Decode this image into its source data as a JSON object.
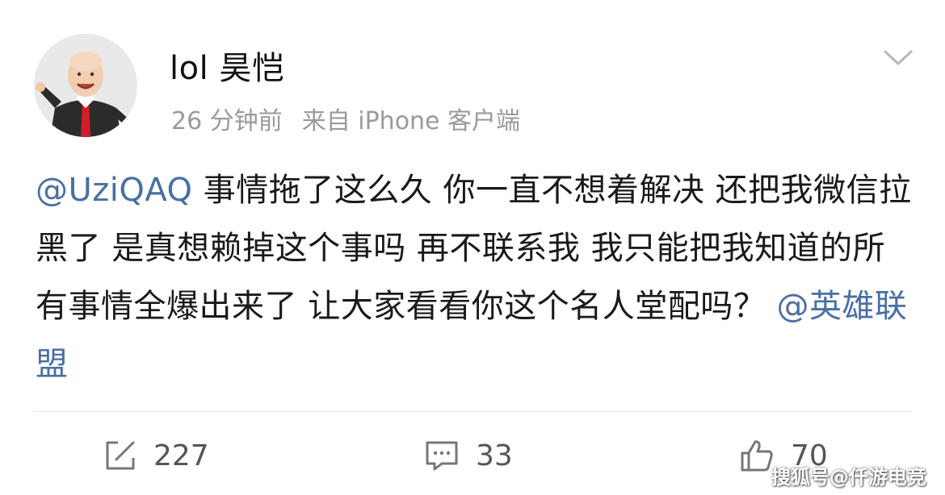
{
  "post": {
    "username": "lol 昊恺",
    "time": "26 分钟前",
    "source": "来自 iPhone 客户端",
    "content": {
      "mention_start": "@UziQAQ",
      "text": " 事情拖了这么久 你一直不想着解决 还把我微信拉黑了 是真想赖掉这个事吗 再不联系我 我只能把我知道的所有事情全爆出来了 让大家看看你这个名人堂配吗？ ",
      "mention_end": "@英雄联盟"
    }
  },
  "actions": {
    "share_count": "227",
    "comment_count": "33",
    "like_count": "70"
  },
  "watermark": "搜狐号@仟游电竞",
  "colors": {
    "mention": "#4a6fa5",
    "meta": "#9a9a9a",
    "icon": "#777777"
  },
  "icons": {
    "menu": "chevron-down-icon",
    "share": "share-icon",
    "comment": "comment-icon",
    "like": "thumbs-up-icon"
  }
}
